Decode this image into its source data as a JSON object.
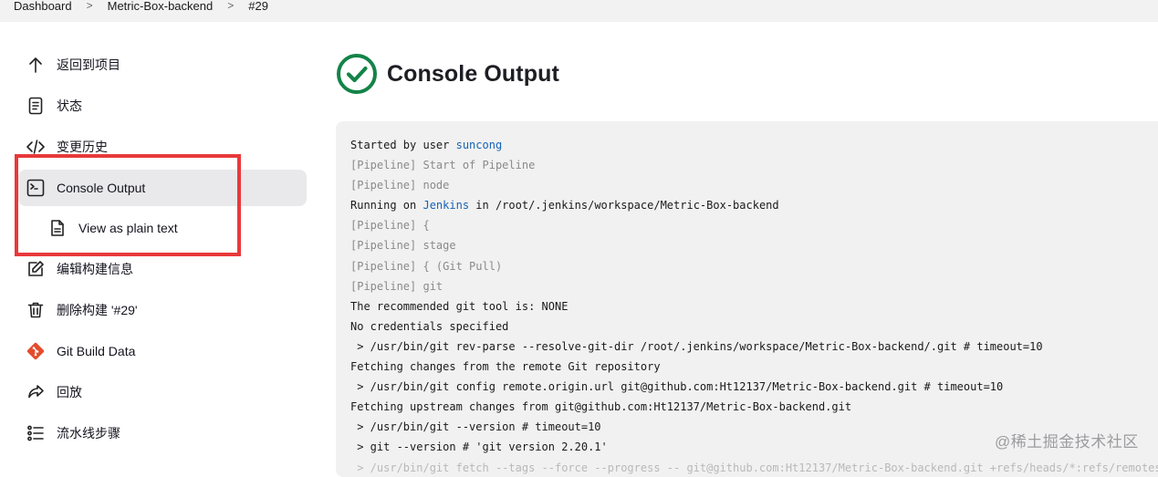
{
  "breadcrumb": {
    "items": [
      "Dashboard",
      "Metric-Box-backend",
      "#29"
    ],
    "separator": ">"
  },
  "sidebar": {
    "items": [
      {
        "label": "返回到项目",
        "icon": "arrow-up-icon"
      },
      {
        "label": "状态",
        "icon": "document-icon"
      },
      {
        "label": "变更历史",
        "icon": "code-icon"
      },
      {
        "label": "Console Output",
        "icon": "terminal-icon",
        "active": true
      },
      {
        "label": "View as plain text",
        "icon": "file-icon"
      },
      {
        "label": "编辑构建信息",
        "icon": "edit-icon"
      },
      {
        "label": "删除构建 '#29'",
        "icon": "trash-icon"
      },
      {
        "label": "Git Build Data",
        "icon": "git-icon"
      },
      {
        "label": "回放",
        "icon": "replay-icon"
      },
      {
        "label": "流水线步骤",
        "icon": "steps-list-icon"
      }
    ]
  },
  "main": {
    "title": "Console Output",
    "status_icon": "success-check-icon",
    "console": {
      "lines": [
        {
          "pre": "Started by user ",
          "link": "suncong",
          "post": "",
          "kind": "normal"
        },
        {
          "text": "[Pipeline] Start of Pipeline",
          "kind": "pipe"
        },
        {
          "text": "[Pipeline] node",
          "kind": "pipe"
        },
        {
          "pre": "Running on ",
          "link": "Jenkins",
          "post": " in /root/.jenkins/workspace/Metric-Box-backend",
          "kind": "normal"
        },
        {
          "text": "[Pipeline] {",
          "kind": "pipe"
        },
        {
          "text": "[Pipeline] stage",
          "kind": "pipe"
        },
        {
          "text": "[Pipeline] { (Git Pull)",
          "kind": "pipe"
        },
        {
          "text": "[Pipeline] git",
          "kind": "pipe"
        },
        {
          "text": "The recommended git tool is: NONE",
          "kind": "normal"
        },
        {
          "text": "No credentials specified",
          "kind": "normal"
        },
        {
          "text": " > /usr/bin/git rev-parse --resolve-git-dir /root/.jenkins/workspace/Metric-Box-backend/.git # timeout=10",
          "kind": "normal"
        },
        {
          "text": "Fetching changes from the remote Git repository",
          "kind": "normal"
        },
        {
          "text": " > /usr/bin/git config remote.origin.url git@github.com:Ht12137/Metric-Box-backend.git # timeout=10",
          "kind": "normal"
        },
        {
          "text": "Fetching upstream changes from git@github.com:Ht12137/Metric-Box-backend.git",
          "kind": "normal"
        },
        {
          "text": " > /usr/bin/git --version # timeout=10",
          "kind": "normal"
        },
        {
          "text": " > git --version # 'git version 2.20.1'",
          "kind": "normal"
        },
        {
          "text": " > /usr/bin/git fetch --tags --force --progress -- git@github.com:Ht12137/Metric-Box-backend.git +refs/heads/*:refs/remotes/origin/*",
          "kind": "cut"
        }
      ]
    }
  },
  "watermark": "@稀土掘金技术社区",
  "colors": {
    "success": "#138347",
    "link": "#1763b5",
    "highlight_border": "#e8393b",
    "git_icon": "#e44c2c"
  }
}
